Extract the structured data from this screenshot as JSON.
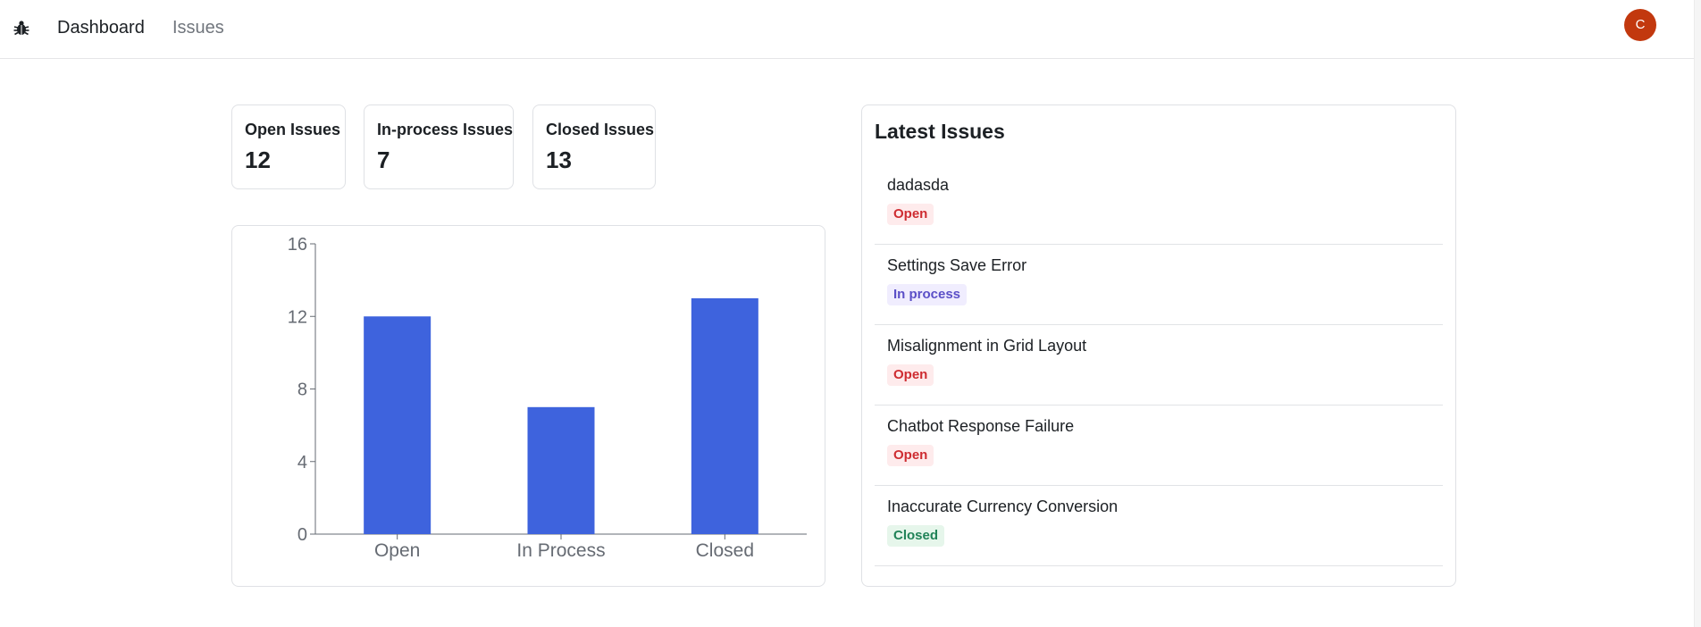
{
  "nav": {
    "logo_icon": "bug-icon",
    "links": [
      {
        "label": "Dashboard",
        "active": true
      },
      {
        "label": "Issues",
        "active": false
      }
    ],
    "avatar_initial": "C",
    "avatar_color": "#c2380e"
  },
  "summary": [
    {
      "label": "Open Issues",
      "value": "12"
    },
    {
      "label": "In-process Issues",
      "value": "7"
    },
    {
      "label": "Closed Issues",
      "value": "13"
    }
  ],
  "chart_data": {
    "type": "bar",
    "categories": [
      "Open",
      "In Process",
      "Closed"
    ],
    "values": [
      12,
      7,
      13
    ],
    "yticks": [
      0,
      4,
      8,
      12,
      16
    ],
    "ylim": [
      0,
      16
    ],
    "bar_color": "#3e63dd",
    "grid": false
  },
  "latest": {
    "title": "Latest Issues",
    "issues": [
      {
        "title": "dadasda",
        "status": "Open",
        "status_kind": "open"
      },
      {
        "title": "Settings Save Error",
        "status": "In process",
        "status_kind": "in-process"
      },
      {
        "title": "Misalignment in Grid Layout",
        "status": "Open",
        "status_kind": "open"
      },
      {
        "title": "Chatbot Response Failure",
        "status": "Open",
        "status_kind": "open"
      },
      {
        "title": "Inaccurate Currency Conversion",
        "status": "Closed",
        "status_kind": "closed"
      }
    ]
  }
}
